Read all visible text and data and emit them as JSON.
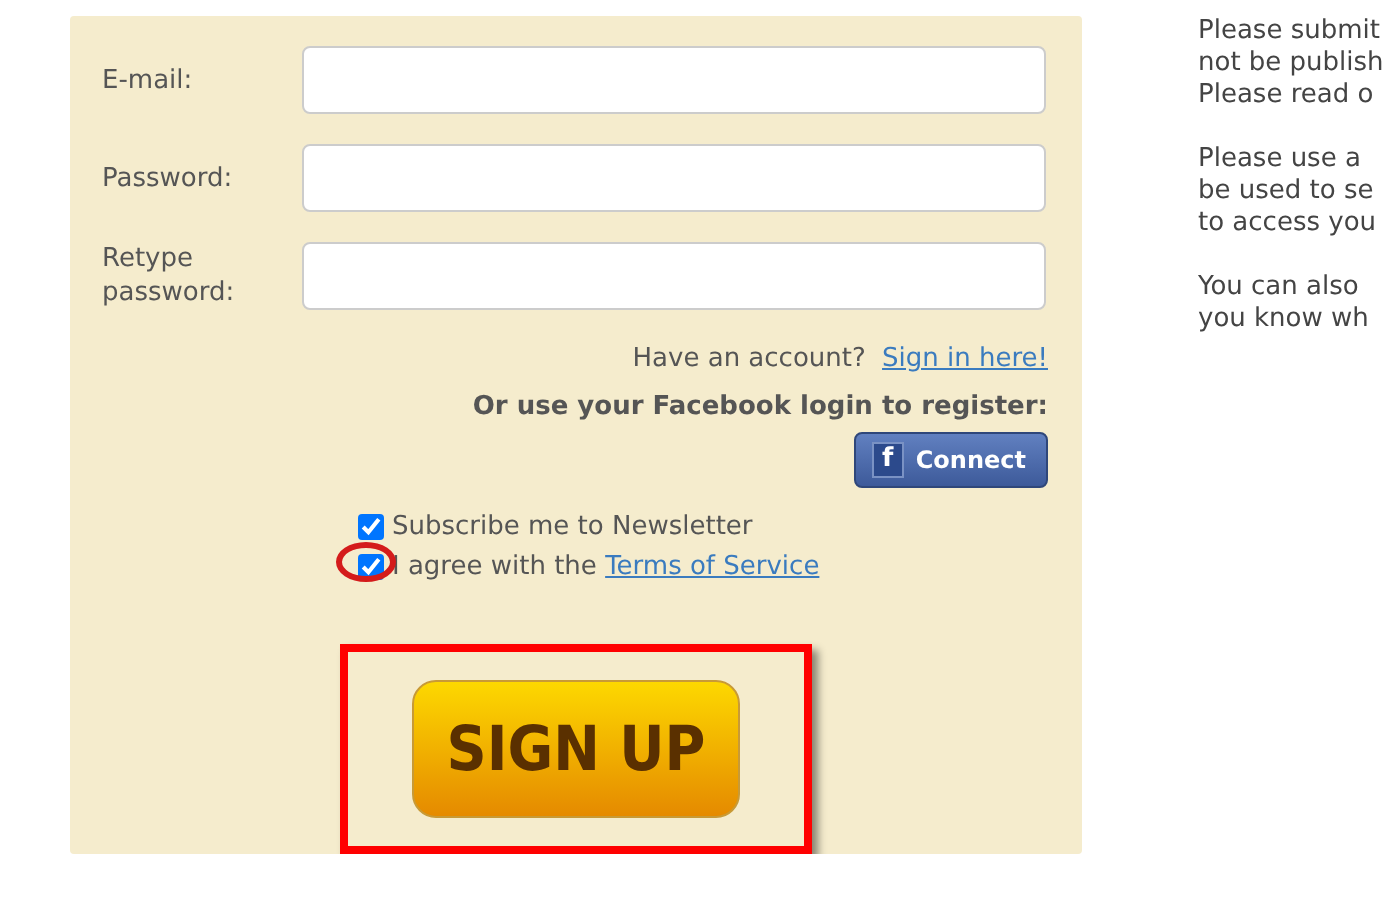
{
  "form": {
    "fields": [
      {
        "label": "E-mail:"
      },
      {
        "label": "Password:"
      },
      {
        "label": "Retype password:"
      }
    ],
    "signin_prompt": "Have an account?",
    "signin_link": "Sign in here!",
    "facebook_prompt": "Or use your Facebook login to register:",
    "facebook_button": {
      "icon": "f",
      "label": "Connect"
    },
    "options": [
      {
        "label": "Subscribe me to Newsletter",
        "checked": true,
        "highlighted": false
      },
      {
        "label": "I agree with the ",
        "link": "Terms of Service",
        "checked": true,
        "highlighted": true
      }
    ],
    "submit": {
      "label": "SIGN UP",
      "highlighted": true
    }
  },
  "info": {
    "paragraphs": [
      [
        "Please submit",
        "not be publish",
        "Please read o"
      ],
      [
        "Please use a",
        "be used to se",
        "to access you"
      ],
      [
        "You can also",
        "you know wh"
      ]
    ]
  }
}
